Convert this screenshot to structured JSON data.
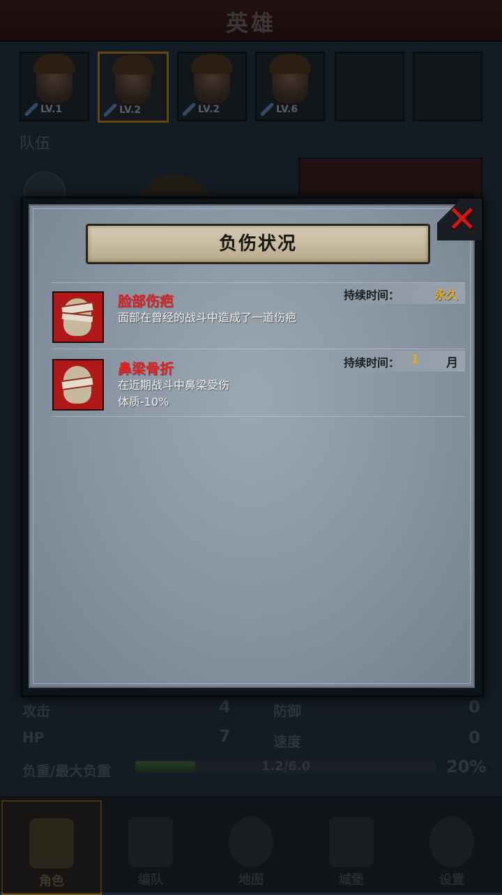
{
  "header": {
    "title": "英雄"
  },
  "heroes": [
    {
      "level": "LV.1"
    },
    {
      "level": "LV.2"
    },
    {
      "level": "LV.2"
    },
    {
      "level": "LV.6"
    }
  ],
  "team_label": "队伍",
  "stats": {
    "attack_label": "攻击",
    "attack_value": "4",
    "defense_label": "防御",
    "defense_value": "0",
    "hp_label": "HP",
    "hp_value": "7",
    "speed_label": "速度",
    "speed_value": "0",
    "weight_label": "负重/最大负重",
    "weight_text": "1.2/6.0",
    "weight_percent": "20%",
    "weight_fraction": 0.2
  },
  "nav": [
    {
      "label": "角色",
      "icon": "knight-icon"
    },
    {
      "label": "编队",
      "icon": "helmet-icon"
    },
    {
      "label": "地图",
      "icon": "compass-icon"
    },
    {
      "label": "城堡",
      "icon": "castle-icon"
    },
    {
      "label": "设置",
      "icon": "gear-icon"
    }
  ],
  "popup": {
    "title": "负伤状况",
    "close_icon": "close-icon",
    "injuries": [
      {
        "name": "脸部伤疤",
        "description": "面部在曾经的战斗中造成了一道伤疤",
        "duration_label": "持续时间：",
        "duration_value": "永久"
      },
      {
        "name": "鼻梁骨折",
        "description": "在近期战斗中鼻梁受伤",
        "effect": "体质-10%",
        "duration_label": "持续时间：",
        "duration_number": "1",
        "duration_unit": "月"
      }
    ]
  }
}
